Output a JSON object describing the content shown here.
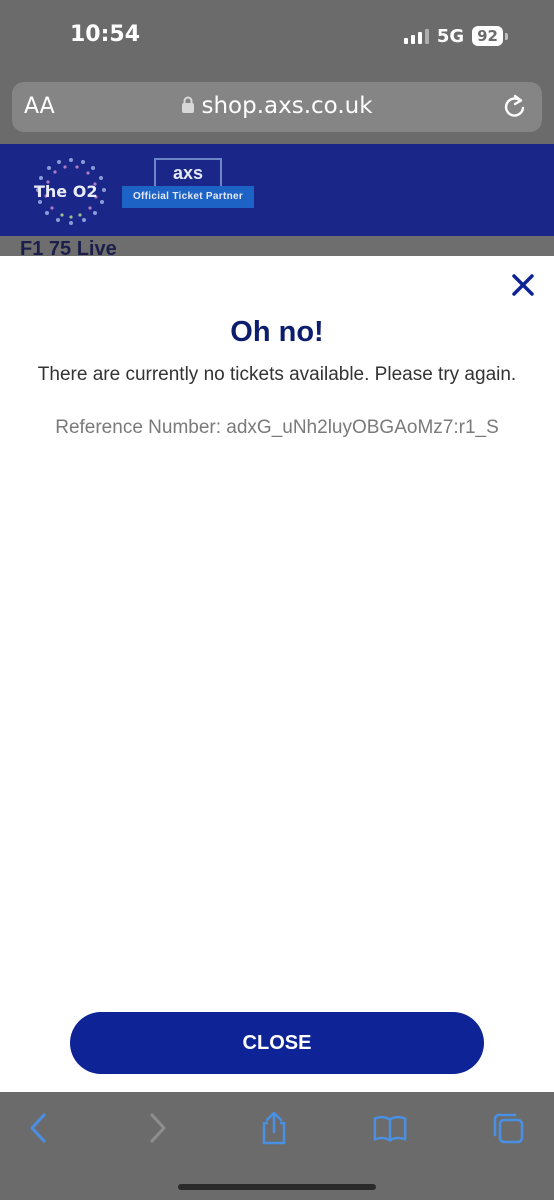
{
  "status_bar": {
    "time": "10:54",
    "network": "5G",
    "battery": "92"
  },
  "browser": {
    "text_size_label": "AA",
    "url": "shop.axs.co.uk"
  },
  "page_header": {
    "logo_text": "The O2",
    "badge_brand": "axs",
    "badge_label": "Official Ticket Partner",
    "behind_text": "F1 75 Live"
  },
  "modal": {
    "title": "Oh no!",
    "message": "There are currently no tickets available. Please try again.",
    "reference": "Reference Number: adxG_uNh2luyOBGAoMz7:r1_S",
    "close_button_label": "CLOSE"
  },
  "toolbar": {
    "items": [
      "back-icon",
      "forward-icon",
      "share-icon",
      "bookmarks-icon",
      "tabs-icon"
    ]
  },
  "colors": {
    "brand_blue": "#0d2396",
    "title_navy": "#0d1d6e",
    "toolbar_icon": "#4a90e2"
  }
}
